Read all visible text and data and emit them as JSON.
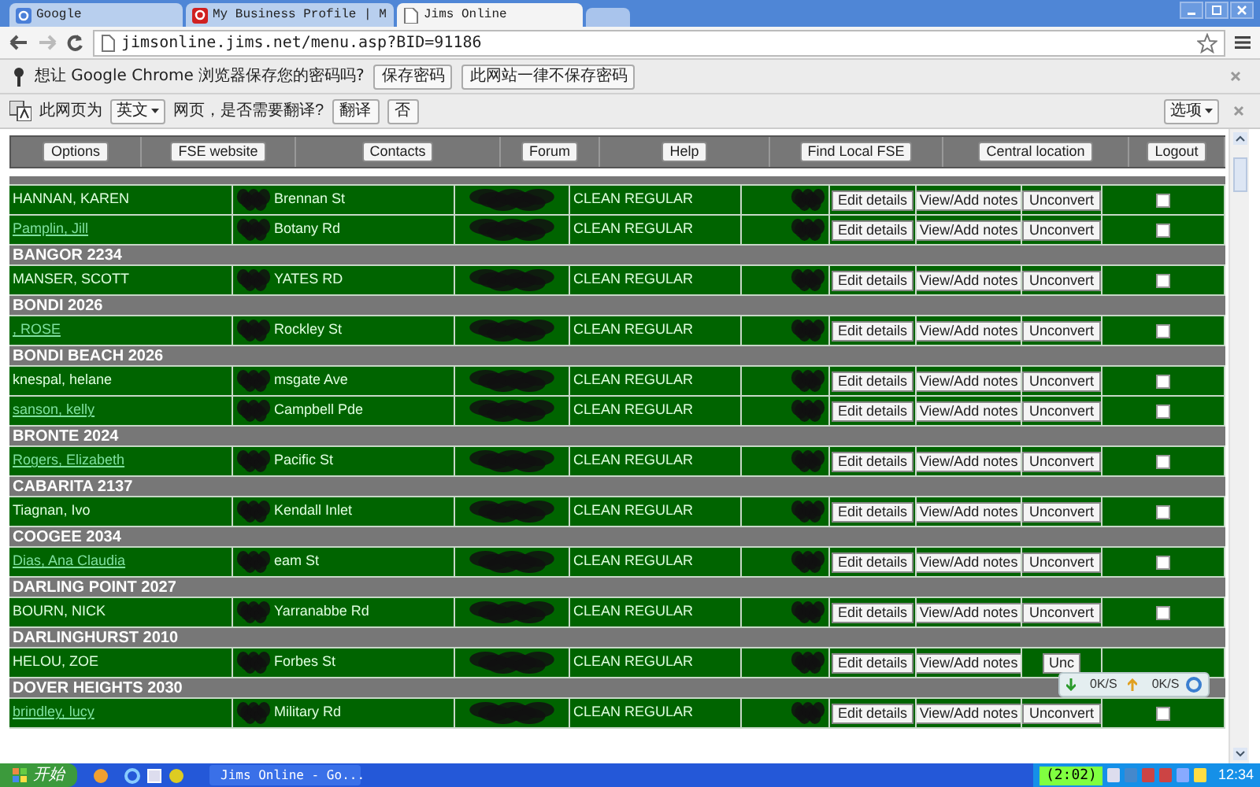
{
  "browser": {
    "tabs": [
      {
        "title": "Google",
        "selected": false
      },
      {
        "title": "My Business Profile | M",
        "selected": false
      },
      {
        "title": "Jims Online",
        "selected": true
      }
    ],
    "address": "jimsonline.jims.net/menu.asp?BID=91186",
    "password_bar": {
      "message": "想让 Google Chrome 浏览器保存您的密码吗?",
      "buttons": [
        "保存密码",
        "此网站一律不保存密码"
      ]
    },
    "translate_bar": {
      "prefix": "此网页为",
      "language": "英文",
      "suffix": "网页，是否需要翻译?",
      "buttons": [
        "翻译",
        "否"
      ],
      "options": "选项"
    }
  },
  "nav": [
    "Options",
    "FSE website",
    "Contacts",
    "Forum",
    "Help",
    "Find Local FSE",
    "Central location",
    "Logout"
  ],
  "rows": [
    {
      "kind": "header",
      "title": ""
    },
    {
      "kind": "client",
      "name": "HANNAN, KAREN",
      "link": false,
      "address": "Brennan St",
      "service": "CLEAN REGULAR",
      "buttons": [
        "Edit details",
        "View/Add notes",
        "Unconvert"
      ],
      "checked": false
    },
    {
      "kind": "client",
      "name": "Pamplin, Jill",
      "link": true,
      "address": "Botany Rd",
      "service": "CLEAN REGULAR",
      "buttons": [
        "Edit details",
        "View/Add notes",
        "Unconvert"
      ],
      "checked": false
    },
    {
      "kind": "header",
      "title": "BANGOR 2234"
    },
    {
      "kind": "client",
      "name": "MANSER, SCOTT",
      "link": false,
      "address": "YATES RD",
      "service": "CLEAN REGULAR",
      "buttons": [
        "Edit details",
        "View/Add notes",
        "Unconvert"
      ],
      "checked": false
    },
    {
      "kind": "header",
      "title": "BONDI 2026"
    },
    {
      "kind": "client",
      "name": ", ROSE",
      "link": true,
      "address": "Rockley St",
      "service": "CLEAN REGULAR",
      "buttons": [
        "Edit details",
        "View/Add notes",
        "Unconvert"
      ],
      "checked": false
    },
    {
      "kind": "header",
      "title": "BONDI BEACH 2026"
    },
    {
      "kind": "client",
      "name": "knespal, helane",
      "link": false,
      "address": "msgate Ave",
      "service": "CLEAN REGULAR",
      "buttons": [
        "Edit details",
        "View/Add notes",
        "Unconvert"
      ],
      "checked": false
    },
    {
      "kind": "client",
      "name": "sanson, kelly",
      "link": true,
      "address": "Campbell Pde",
      "service": "CLEAN REGULAR",
      "buttons": [
        "Edit details",
        "View/Add notes",
        "Unconvert"
      ],
      "checked": false
    },
    {
      "kind": "header",
      "title": "BRONTE 2024"
    },
    {
      "kind": "client",
      "name": "Rogers, Elizabeth",
      "link": true,
      "address": "Pacific St",
      "service": "CLEAN REGULAR",
      "buttons": [
        "Edit details",
        "View/Add notes",
        "Unconvert"
      ],
      "checked": false
    },
    {
      "kind": "header",
      "title": "CABARITA 2137"
    },
    {
      "kind": "client",
      "name": "Tiagnan, Ivo",
      "link": false,
      "address": "Kendall Inlet",
      "service": "CLEAN REGULAR",
      "buttons": [
        "Edit details",
        "View/Add notes",
        "Unconvert"
      ],
      "checked": false
    },
    {
      "kind": "header",
      "title": "COOGEE 2034"
    },
    {
      "kind": "client",
      "name": "Dias, Ana Claudia",
      "link": true,
      "address": "eam St",
      "service": "CLEAN REGULAR",
      "buttons": [
        "Edit details",
        "View/Add notes",
        "Unconvert"
      ],
      "checked": false
    },
    {
      "kind": "header",
      "title": "DARLING POINT 2027"
    },
    {
      "kind": "client",
      "name": "BOURN, NICK",
      "link": false,
      "address": "Yarranabbe Rd",
      "service": "CLEAN REGULAR",
      "buttons": [
        "Edit details",
        "View/Add notes",
        "Unconvert"
      ],
      "checked": false
    },
    {
      "kind": "header",
      "title": "DARLINGHURST 2010"
    },
    {
      "kind": "client",
      "name": "HELOU, ZOE",
      "link": false,
      "address": "Forbes St",
      "service": "CLEAN REGULAR",
      "buttons": [
        "Edit details",
        "View/Add notes",
        "Unc"
      ]
    },
    {
      "kind": "header",
      "title": "DOVER HEIGHTS 2030"
    },
    {
      "kind": "client",
      "name": "brindley, lucy",
      "link": true,
      "address": "Military Rd",
      "service": "CLEAN REGULAR",
      "buttons": [
        "Edit details",
        "View/Add notes",
        "Unconvert"
      ],
      "checked": false
    }
  ],
  "speed_widget": {
    "download": "0K/S",
    "upload": "0K/S"
  },
  "taskbar": {
    "start": "开始",
    "window": "Jims Online - Go...",
    "counter": "(2:02)",
    "clock": "12:34"
  }
}
